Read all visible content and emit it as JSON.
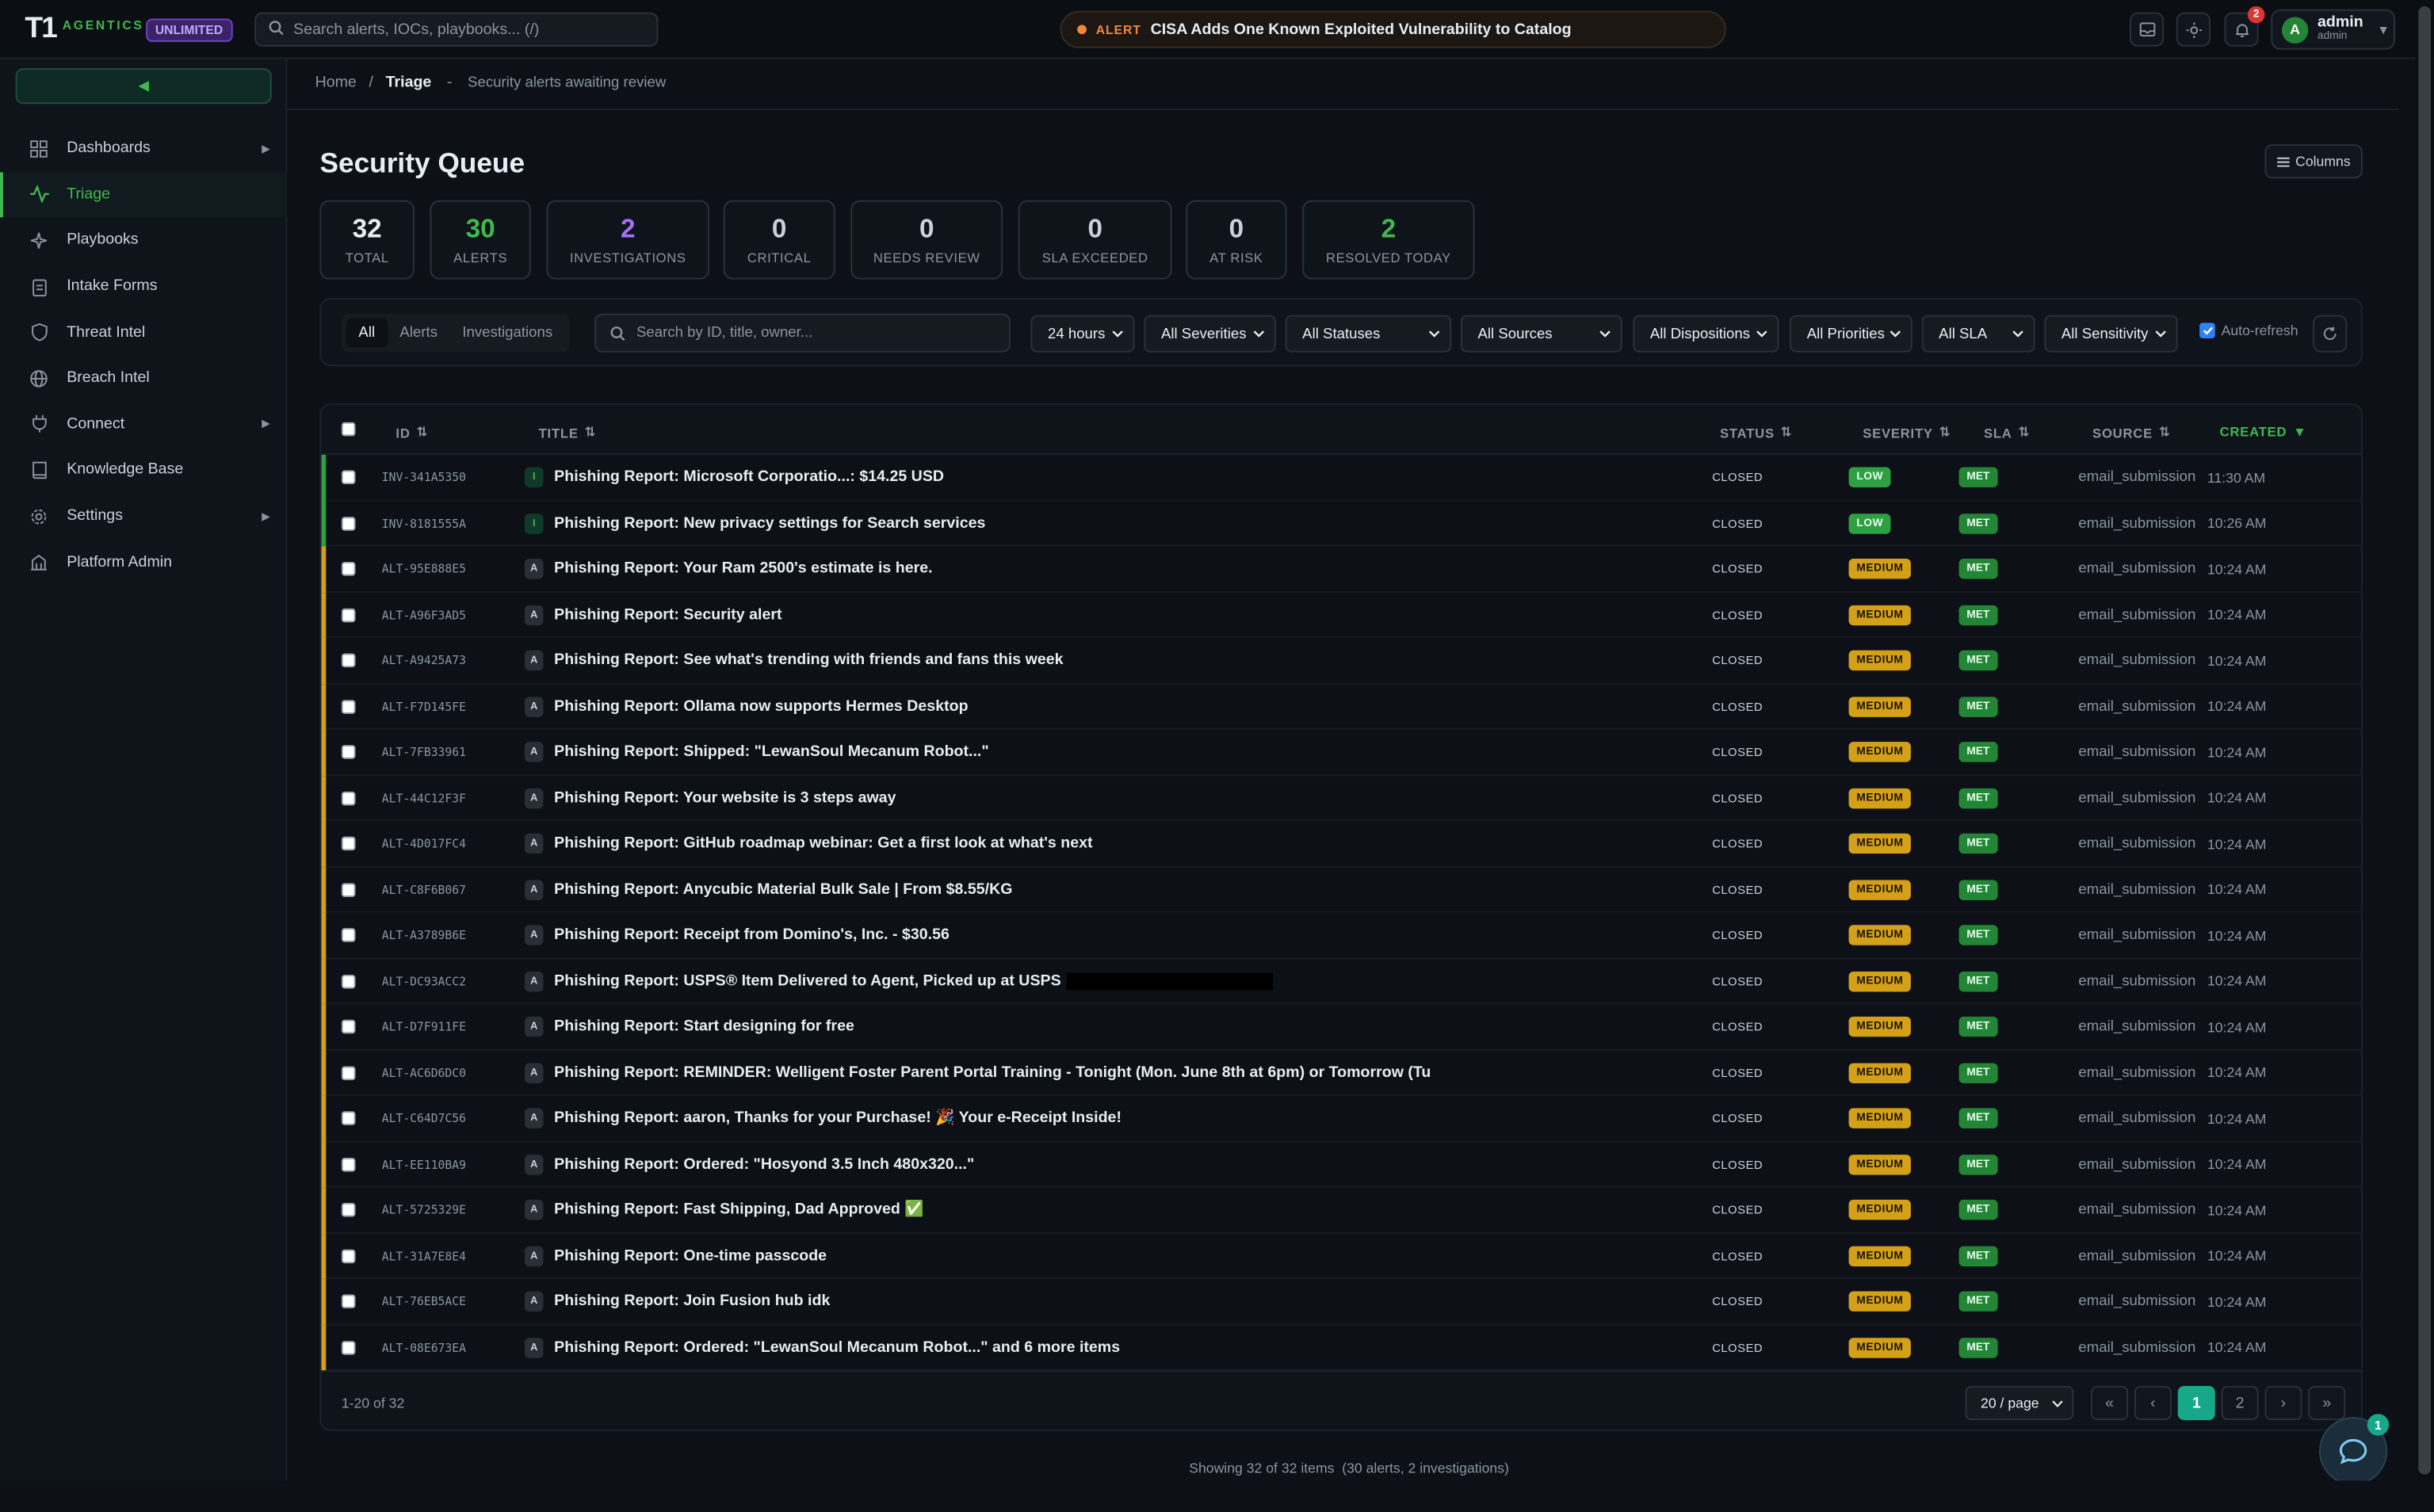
{
  "app": {
    "logo_mark": "T1",
    "logo_text": "AGENTICS",
    "plan": "UNLIMITED"
  },
  "topbar": {
    "search_placeholder": "Search alerts, IOCs, playbooks... (/)",
    "alert_tag": "ALERT",
    "alert_text": "CISA Adds One Known Exploited Vulnerability to Catalog",
    "notification_count": "2",
    "user": {
      "initial": "A",
      "name": "admin",
      "role": "admin"
    }
  },
  "sidebar": {
    "items": [
      {
        "label": "Dashboards",
        "icon": "grid-icon",
        "expandable": true,
        "active": false
      },
      {
        "label": "Triage",
        "icon": "activity-icon",
        "expandable": false,
        "active": true
      },
      {
        "label": "Playbooks",
        "icon": "sparkles-icon",
        "expandable": false,
        "active": false
      },
      {
        "label": "Intake Forms",
        "icon": "clipboard-icon",
        "expandable": false,
        "active": false
      },
      {
        "label": "Threat Intel",
        "icon": "shield-icon",
        "expandable": false,
        "active": false
      },
      {
        "label": "Breach Intel",
        "icon": "globe-icon",
        "expandable": false,
        "active": false
      },
      {
        "label": "Connect",
        "icon": "plug-icon",
        "expandable": true,
        "active": false
      },
      {
        "label": "Knowledge Base",
        "icon": "book-icon",
        "expandable": false,
        "active": false
      },
      {
        "label": "Settings",
        "icon": "gear-icon",
        "expandable": true,
        "active": false
      },
      {
        "label": "Platform Admin",
        "icon": "building-icon",
        "expandable": false,
        "active": false
      }
    ]
  },
  "breadcrumb": {
    "home": "Home",
    "sep": "/",
    "current": "Triage",
    "dash": "-",
    "subtitle": "Security alerts awaiting review"
  },
  "page": {
    "title": "Security Queue",
    "columns_label": "Columns"
  },
  "stats": [
    {
      "value": "32",
      "label": "TOTAL",
      "color": "#e6edf3"
    },
    {
      "value": "30",
      "label": "ALERTS",
      "color": "#3fb950"
    },
    {
      "value": "2",
      "label": "INVESTIGATIONS",
      "color": "#a371f7"
    },
    {
      "value": "0",
      "label": "CRITICAL",
      "color": "#c9d1d9"
    },
    {
      "value": "0",
      "label": "NEEDS REVIEW",
      "color": "#c9d1d9"
    },
    {
      "value": "0",
      "label": "SLA EXCEEDED",
      "color": "#c9d1d9"
    },
    {
      "value": "0",
      "label": "AT RISK",
      "color": "#c9d1d9"
    },
    {
      "value": "2",
      "label": "RESOLVED TODAY",
      "color": "#3fb950"
    }
  ],
  "filters": {
    "segments": [
      "All",
      "Alerts",
      "Investigations"
    ],
    "search_placeholder": "Search by ID, title, owner...",
    "dropdowns": [
      "24 hours",
      "All Severities",
      "All Statuses",
      "All Sources",
      "All Dispositions",
      "All Priorities",
      "All SLA",
      "All Sensitivity"
    ],
    "auto_refresh_label": "Auto-refresh",
    "auto_refresh_on": true
  },
  "table": {
    "headers": {
      "id": "ID",
      "title": "TITLE",
      "status": "STATUS",
      "severity": "SEVERITY",
      "sla": "SLA",
      "source": "SOURCE",
      "created": "CREATED"
    },
    "rows": [
      {
        "id": "INV-341A5350",
        "type": "I",
        "title": "Phishing Report: Microsoft Corporatio...: $14.25 USD",
        "status": "CLOSED",
        "severity": "LOW",
        "sla": "MET",
        "source": "email_submission",
        "created": "11:30 AM"
      },
      {
        "id": "INV-8181555A",
        "type": "I",
        "title": "Phishing Report: New privacy settings for Search services",
        "status": "CLOSED",
        "severity": "LOW",
        "sla": "MET",
        "source": "email_submission",
        "created": "10:26 AM"
      },
      {
        "id": "ALT-95E888E5",
        "type": "A",
        "title": "Phishing Report: Your Ram 2500's estimate is here.",
        "status": "CLOSED",
        "severity": "MEDIUM",
        "sla": "MET",
        "source": "email_submission",
        "created": "10:24 AM"
      },
      {
        "id": "ALT-A96F3AD5",
        "type": "A",
        "title": "Phishing Report: Security alert",
        "status": "CLOSED",
        "severity": "MEDIUM",
        "sla": "MET",
        "source": "email_submission",
        "created": "10:24 AM"
      },
      {
        "id": "ALT-A9425A73",
        "type": "A",
        "title": "Phishing Report: See what's trending with friends and fans this week",
        "status": "CLOSED",
        "severity": "MEDIUM",
        "sla": "MET",
        "source": "email_submission",
        "created": "10:24 AM"
      },
      {
        "id": "ALT-F7D145FE",
        "type": "A",
        "title": "Phishing Report: Ollama now supports Hermes Desktop",
        "status": "CLOSED",
        "severity": "MEDIUM",
        "sla": "MET",
        "source": "email_submission",
        "created": "10:24 AM"
      },
      {
        "id": "ALT-7FB33961",
        "type": "A",
        "title": "Phishing Report: Shipped: \"LewanSoul Mecanum Robot...\"",
        "status": "CLOSED",
        "severity": "MEDIUM",
        "sla": "MET",
        "source": "email_submission",
        "created": "10:24 AM"
      },
      {
        "id": "ALT-44C12F3F",
        "type": "A",
        "title": "Phishing Report: Your website is 3 steps away",
        "status": "CLOSED",
        "severity": "MEDIUM",
        "sla": "MET",
        "source": "email_submission",
        "created": "10:24 AM"
      },
      {
        "id": "ALT-4D017FC4",
        "type": "A",
        "title": "Phishing Report: GitHub roadmap webinar: Get a first look at what's next",
        "status": "CLOSED",
        "severity": "MEDIUM",
        "sla": "MET",
        "source": "email_submission",
        "created": "10:24 AM"
      },
      {
        "id": "ALT-C8F6B067",
        "type": "A",
        "title": "Phishing Report: Anycubic Material Bulk Sale | From $8.55/KG",
        "status": "CLOSED",
        "severity": "MEDIUM",
        "sla": "MET",
        "source": "email_submission",
        "created": "10:24 AM"
      },
      {
        "id": "ALT-A3789B6E",
        "type": "A",
        "title": "Phishing Report: Receipt from Domino's, Inc. - $30.56",
        "status": "CLOSED",
        "severity": "MEDIUM",
        "sla": "MET",
        "source": "email_submission",
        "created": "10:24 AM"
      },
      {
        "id": "ALT-DC93ACC2",
        "type": "A",
        "title": "Phishing Report: USPS® Item Delivered to Agent, Picked up at USPS",
        "redacted": true,
        "status": "CLOSED",
        "severity": "MEDIUM",
        "sla": "MET",
        "source": "email_submission",
        "created": "10:24 AM"
      },
      {
        "id": "ALT-D7F911FE",
        "type": "A",
        "title": "Phishing Report: Start designing for free",
        "status": "CLOSED",
        "severity": "MEDIUM",
        "sla": "MET",
        "source": "email_submission",
        "created": "10:24 AM"
      },
      {
        "id": "ALT-AC6D6DC0",
        "type": "A",
        "title": "Phishing Report: REMINDER: Welligent Foster Parent Portal Training - Tonight (Mon. June 8th at 6pm) or Tomorrow (Tu",
        "status": "CLOSED",
        "severity": "MEDIUM",
        "sla": "MET",
        "source": "email_submission",
        "created": "10:24 AM"
      },
      {
        "id": "ALT-C64D7C56",
        "type": "A",
        "title": "Phishing Report: aaron, Thanks for your Purchase! 🎉 Your e-Receipt Inside!",
        "status": "CLOSED",
        "severity": "MEDIUM",
        "sla": "MET",
        "source": "email_submission",
        "created": "10:24 AM"
      },
      {
        "id": "ALT-EE110BA9",
        "type": "A",
        "title": "Phishing Report: Ordered: \"Hosyond 3.5 Inch 480x320...\"",
        "status": "CLOSED",
        "severity": "MEDIUM",
        "sla": "MET",
        "source": "email_submission",
        "created": "10:24 AM"
      },
      {
        "id": "ALT-5725329E",
        "type": "A",
        "title": "Phishing Report: Fast Shipping, Dad Approved ✅",
        "status": "CLOSED",
        "severity": "MEDIUM",
        "sla": "MET",
        "source": "email_submission",
        "created": "10:24 AM"
      },
      {
        "id": "ALT-31A7E8E4",
        "type": "A",
        "title": "Phishing Report: One-time passcode",
        "status": "CLOSED",
        "severity": "MEDIUM",
        "sla": "MET",
        "source": "email_submission",
        "created": "10:24 AM"
      },
      {
        "id": "ALT-76EB5ACE",
        "type": "A",
        "title": "Phishing Report: Join Fusion hub idk",
        "status": "CLOSED",
        "severity": "MEDIUM",
        "sla": "MET",
        "source": "email_submission",
        "created": "10:24 AM"
      },
      {
        "id": "ALT-08E673EA",
        "type": "A",
        "title": "Phishing Report: Ordered: \"LewanSoul Mecanum Robot...\" and 6 more items",
        "status": "CLOSED",
        "severity": "MEDIUM",
        "sla": "MET",
        "source": "email_submission",
        "created": "10:24 AM"
      }
    ]
  },
  "pagination": {
    "range": "1-20 of 32",
    "per_page": "20 / page",
    "first": "«",
    "prev": "‹",
    "pages": [
      "1",
      "2"
    ],
    "current": "1",
    "next": "›",
    "last": "»"
  },
  "footer": {
    "showing": "Showing 32 of 32 items  (30 alerts, 2 investigations)"
  },
  "chat": {
    "badge": "1"
  },
  "colors": {
    "accent": "#3fb950",
    "low": "#2ea043",
    "medium": "#d4a017",
    "met": "#238636",
    "investigation_bar": "#2ea043",
    "alert_bar": "#d4a017"
  }
}
